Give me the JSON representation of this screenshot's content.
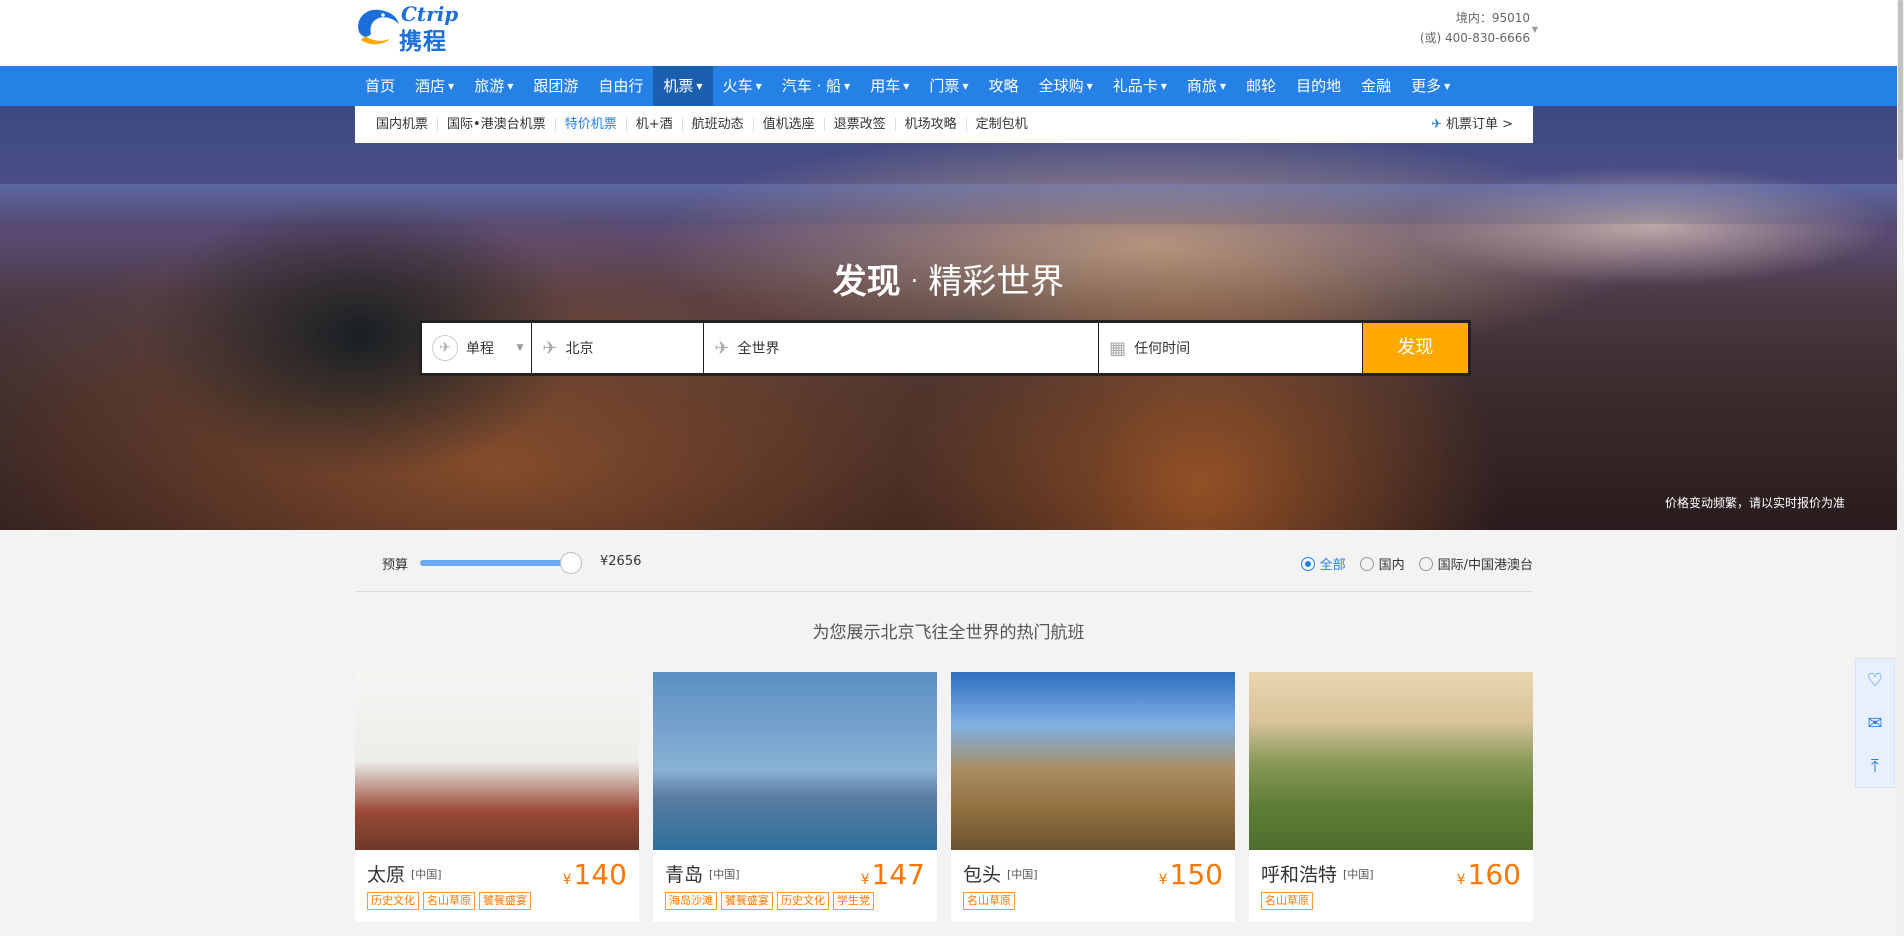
{
  "header": {
    "logo_en": "Ctrip",
    "logo_cn": "携程",
    "hotline_domestic": "境内：95010",
    "hotline_alt": "(或) 400-830-6666"
  },
  "nav": [
    {
      "label": "首页",
      "dropdown": false,
      "active": false
    },
    {
      "label": "酒店",
      "dropdown": true,
      "active": false
    },
    {
      "label": "旅游",
      "dropdown": true,
      "active": false
    },
    {
      "label": "跟团游",
      "dropdown": false,
      "active": false
    },
    {
      "label": "自由行",
      "dropdown": false,
      "active": false
    },
    {
      "label": "机票",
      "dropdown": true,
      "active": true
    },
    {
      "label": "火车",
      "dropdown": true,
      "active": false
    },
    {
      "label": "汽车 · 船",
      "dropdown": true,
      "active": false
    },
    {
      "label": "用车",
      "dropdown": true,
      "active": false
    },
    {
      "label": "门票",
      "dropdown": true,
      "active": false
    },
    {
      "label": "攻略",
      "dropdown": false,
      "active": false
    },
    {
      "label": "全球购",
      "dropdown": true,
      "active": false
    },
    {
      "label": "礼品卡",
      "dropdown": true,
      "active": false
    },
    {
      "label": "商旅",
      "dropdown": true,
      "active": false
    },
    {
      "label": "邮轮",
      "dropdown": false,
      "active": false
    },
    {
      "label": "目的地",
      "dropdown": false,
      "active": false
    },
    {
      "label": "金融",
      "dropdown": false,
      "active": false
    },
    {
      "label": "更多",
      "dropdown": true,
      "active": false
    }
  ],
  "subnav": {
    "items": [
      "国内机票",
      "国际•港澳台机票",
      "特价机票",
      "机+酒",
      "航班动态",
      "值机选座",
      "退票改签",
      "机场攻略",
      "定制包机"
    ],
    "current": "特价机票",
    "orders": "机票订单 >"
  },
  "hero": {
    "title_bold": "发现",
    "title_dot": "·",
    "title_rest": "精彩世界",
    "note": "价格变动频繁，请以实时报价为准"
  },
  "search": {
    "trip_type": "单程",
    "from": "北京",
    "to": "全世界",
    "date": "任何时间",
    "button": "发现"
  },
  "filter": {
    "budget_label": "预算",
    "budget_value": "¥2656",
    "budget_fraction": 0.9,
    "scope_options": [
      {
        "label": "全部",
        "checked": true
      },
      {
        "label": "国内",
        "checked": false
      },
      {
        "label": "国际/中国港澳台",
        "checked": false
      }
    ]
  },
  "section_title": "为您展示北京飞往全世界的热门航班",
  "destinations": [
    {
      "city": "太原",
      "country": "[中国]",
      "currency": "¥",
      "price": "140",
      "tags": [
        "历史文化",
        "名山草原",
        "饕餮盛宴"
      ],
      "image": "pagoda-photo"
    },
    {
      "city": "青岛",
      "country": "[中国]",
      "currency": "¥",
      "price": "147",
      "tags": [
        "海岛沙滩",
        "饕餮盛宴",
        "历史文化",
        "学生党"
      ],
      "image": "lighthouse-photo"
    },
    {
      "city": "包头",
      "country": "[中国]",
      "currency": "¥",
      "price": "150",
      "tags": [
        "名山草原"
      ],
      "image": "monastery-photo"
    },
    {
      "city": "呼和浩特",
      "country": "[中国]",
      "currency": "¥",
      "price": "160",
      "tags": [
        "名山草原"
      ],
      "image": "great-wall-photo"
    }
  ],
  "sidebar": {
    "icons": [
      "heart-icon",
      "message-icon",
      "back-to-top-icon"
    ]
  },
  "colors": {
    "brand_blue": "#2681e6",
    "nav_active": "#1b5fb0",
    "button_orange": "#ffa800",
    "price_orange": "#ff7700"
  }
}
